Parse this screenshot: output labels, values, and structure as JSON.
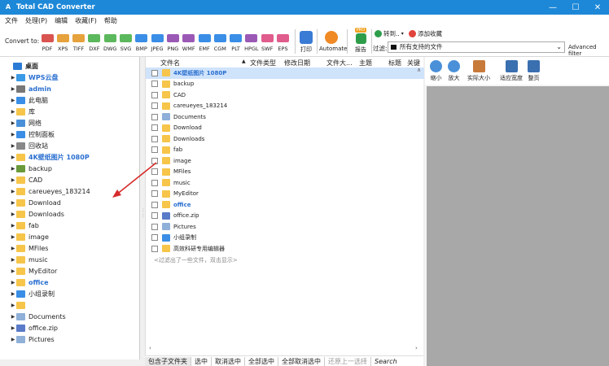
{
  "window": {
    "title": "Total CAD Converter",
    "app_icon": "A",
    "minimize": "—",
    "maximize": "☐",
    "close": "✕"
  },
  "menu": [
    "文件",
    "处理(P)",
    "编辑",
    "收藏(F)",
    "帮助"
  ],
  "toolbar": {
    "convert_label": "Convert to:",
    "formats": [
      {
        "label": "PDF",
        "color": "#d9534f"
      },
      {
        "label": "XPS",
        "color": "#e6a23c"
      },
      {
        "label": "TIFF",
        "color": "#e6a23c"
      },
      {
        "label": "DXF",
        "color": "#5cb85c"
      },
      {
        "label": "DWG",
        "color": "#5cb85c"
      },
      {
        "label": "SVG",
        "color": "#5cb85c"
      },
      {
        "label": "BMP",
        "color": "#3a8ee6"
      },
      {
        "label": "JPEG",
        "color": "#3a8ee6"
      },
      {
        "label": "PNG",
        "color": "#9b59b6"
      },
      {
        "label": "WMF",
        "color": "#9b59b6"
      },
      {
        "label": "EMF",
        "color": "#3a8ee6"
      },
      {
        "label": "CGM",
        "color": "#3a8ee6"
      },
      {
        "label": "PLT",
        "color": "#3a8ee6"
      },
      {
        "label": "HPGL",
        "color": "#9b59b6"
      },
      {
        "label": "SWF",
        "color": "#e05c8c"
      },
      {
        "label": "EPS",
        "color": "#e05c8c"
      }
    ],
    "print_label": "打印",
    "automate_label": "Automate",
    "report_label": "报告",
    "report_badge": "PRO",
    "goto_label": "转到..",
    "add_fav_label": "添加收藏",
    "filter_label": "过滤:",
    "filter_value": "所有支持的文件",
    "advanced_filter": "Advanced filter"
  },
  "tree": [
    {
      "label": "桌面",
      "level": 0,
      "type": "desktop",
      "arrow": ""
    },
    {
      "label": "WPS云盘",
      "level": 1,
      "type": "cloud",
      "arrow": "▶",
      "style": "blue"
    },
    {
      "label": "admin",
      "level": 1,
      "type": "user",
      "arrow": "▶",
      "style": "blue"
    },
    {
      "label": "此电脑",
      "level": 1,
      "type": "pc",
      "arrow": "▶"
    },
    {
      "label": "库",
      "level": 1,
      "type": "folder",
      "arrow": "▶"
    },
    {
      "label": "网络",
      "level": 1,
      "type": "net",
      "arrow": "▶"
    },
    {
      "label": "控制面板",
      "level": 1,
      "type": "panel",
      "arrow": "▶"
    },
    {
      "label": "回收站",
      "level": 1,
      "type": "bin",
      "arrow": "▶"
    },
    {
      "label": "4K壁纸图片 1080P",
      "level": 1,
      "type": "folder",
      "arrow": "▶",
      "style": "blue"
    },
    {
      "label": "backup",
      "level": 1,
      "type": "drive",
      "arrow": "▶"
    },
    {
      "label": "CAD",
      "level": 1,
      "type": "folder",
      "arrow": "▶"
    },
    {
      "label": "careueyes_183214",
      "level": 1,
      "type": "folder",
      "arrow": "▶"
    },
    {
      "label": "Download",
      "level": 1,
      "type": "folder",
      "arrow": "▶"
    },
    {
      "label": "Downloads",
      "level": 1,
      "type": "folder",
      "arrow": "▶"
    },
    {
      "label": "fab",
      "level": 1,
      "type": "folder",
      "arrow": "▶"
    },
    {
      "label": "image",
      "level": 1,
      "type": "folder",
      "arrow": "▶"
    },
    {
      "label": "MFiles",
      "level": 1,
      "type": "folder",
      "arrow": "▶"
    },
    {
      "label": "music",
      "level": 1,
      "type": "folder",
      "arrow": "▶"
    },
    {
      "label": "MyEditor",
      "level": 1,
      "type": "folder",
      "arrow": "▶"
    },
    {
      "label": "office",
      "level": 1,
      "type": "folder",
      "arrow": "▶",
      "style": "blue"
    },
    {
      "label": "小组录制",
      "level": 1,
      "type": "pc",
      "arrow": "▶"
    },
    {
      "label": "",
      "level": 1,
      "type": "folder",
      "arrow": "▶"
    },
    {
      "label": "Documents",
      "level": 1,
      "type": "doc",
      "arrow": "▶"
    },
    {
      "label": "office.zip",
      "level": 1,
      "type": "zip",
      "arrow": "▶"
    },
    {
      "label": "Pictures",
      "level": 1,
      "type": "doc",
      "arrow": "▶"
    }
  ],
  "columns": [
    "文件名",
    "文件类型",
    "修改日期",
    "文件大...",
    "主题",
    "标题",
    "关键"
  ],
  "files": [
    {
      "name": "4K壁纸图片 1080P",
      "type": "folder",
      "selected": true,
      "style": "blue"
    },
    {
      "name": "backup",
      "type": "folder"
    },
    {
      "name": "CAD",
      "type": "folder"
    },
    {
      "name": "careueyes_183214",
      "type": "folder"
    },
    {
      "name": "Documents",
      "type": "doc"
    },
    {
      "name": "Download",
      "type": "folder"
    },
    {
      "name": "Downloads",
      "type": "folder"
    },
    {
      "name": "fab",
      "type": "folder"
    },
    {
      "name": "image",
      "type": "folder"
    },
    {
      "name": "MFiles",
      "type": "folder"
    },
    {
      "name": "music",
      "type": "folder"
    },
    {
      "name": "MyEditor",
      "type": "folder"
    },
    {
      "name": "office",
      "type": "folder",
      "style": "blue"
    },
    {
      "name": "office.zip",
      "type": "zip"
    },
    {
      "name": "Pictures",
      "type": "doc"
    },
    {
      "name": "小组录制",
      "type": "pc"
    },
    {
      "name": "高效科研专用编辑器",
      "type": "folder"
    }
  ],
  "hint": "<过滤出了一些文件，双击显示>",
  "preview_toolbar": [
    {
      "label": "缩小",
      "icon": "zoom-out-icon"
    },
    {
      "label": "放大",
      "icon": "zoom-in-icon"
    },
    {
      "label": "实际大小",
      "icon": "actual-size-icon"
    },
    {
      "label": "适应宽度",
      "icon": "fit-width-icon"
    },
    {
      "label": "整页",
      "icon": "full-page-icon"
    }
  ],
  "bottom": {
    "include_subfolders": "包含子文件夹",
    "select": "选中",
    "deselect": "取消选中",
    "select_all": "全部选中",
    "deselect_all": "全部取消选中",
    "select_previous": "还原上一选择",
    "search": "Search"
  }
}
